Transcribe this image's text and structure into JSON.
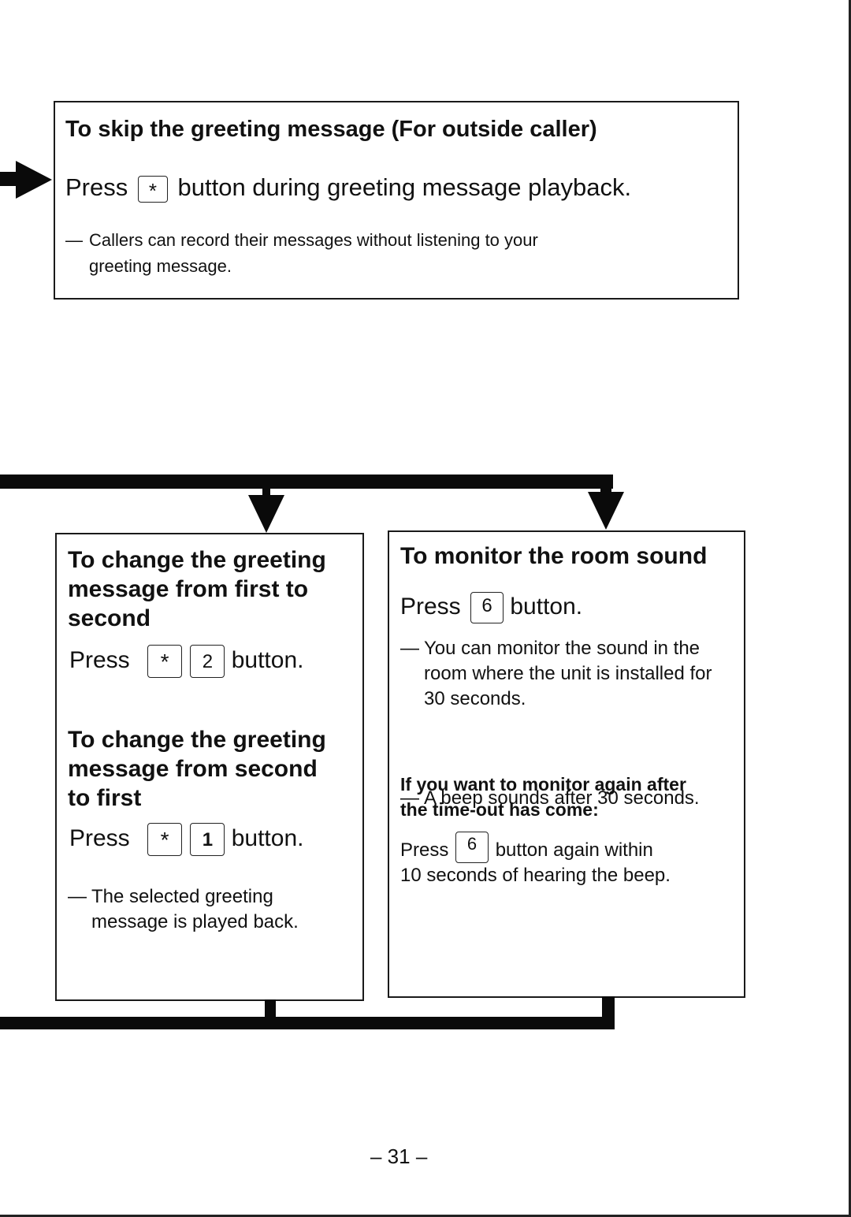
{
  "skip_section": {
    "heading": "To skip the greeting message (For outside caller)",
    "press_label": "Press",
    "keys": [
      "*"
    ],
    "instruction_rest": "button during greeting message playback.",
    "note_dash": "—",
    "note_line1": "Callers can record their messages without listening to your",
    "note_line2": "greeting message."
  },
  "change_first_to_second": {
    "heading_line1": "To change the greeting",
    "heading_line2": "message from first to",
    "heading_line3": "second",
    "press_label": "Press",
    "keys": [
      "*",
      "2"
    ],
    "instruction_rest": "button."
  },
  "change_second_to_first": {
    "heading_line1": "To change the greeting",
    "heading_line2": "message from second",
    "heading_line3": "to first",
    "press_label": "Press",
    "keys": [
      "*",
      "1"
    ],
    "instruction_rest": "button.",
    "note_dash": "—",
    "note_line1": "The selected greeting",
    "note_line2": "message is played back."
  },
  "monitor_section": {
    "heading": "To monitor the room sound",
    "press_label": "Press",
    "keys": [
      "6"
    ],
    "instruction_rest": "button.",
    "notes": [
      {
        "dash": "—",
        "lines": [
          "You can monitor the sound in the",
          "room where the unit is installed for",
          "30 seconds."
        ]
      },
      {
        "dash": "—",
        "lines": [
          "A beep sounds after 30 seconds."
        ]
      }
    ],
    "sub_heading_line1": "If you want to monitor again after",
    "sub_heading_line2": "the time-out has come:",
    "again_press_label": "Press",
    "again_keys": [
      "6"
    ],
    "again_rest_line1": "button again within",
    "again_rest_line2": "10 seconds of hearing the beep."
  },
  "page_number": "– 31 –"
}
